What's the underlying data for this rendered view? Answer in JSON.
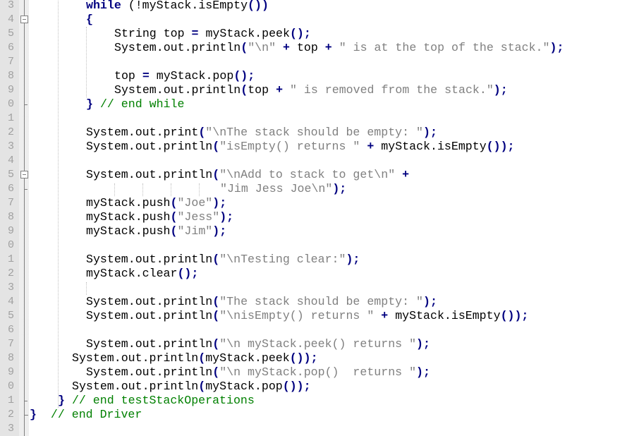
{
  "editor": {
    "lines": [
      {
        "number": "3",
        "indent": 8,
        "tokens": [
          {
            "t": "kw",
            "v": "while"
          },
          {
            "t": "tx",
            "v": " ("
          },
          {
            "t": "tx",
            "v": "!myStack.isEmpty"
          },
          {
            "t": "op",
            "v": "())"
          }
        ]
      },
      {
        "number": "4",
        "indent": 8,
        "tokens": [
          {
            "t": "op",
            "v": "{"
          }
        ]
      },
      {
        "number": "5",
        "indent": 12,
        "tokens": [
          {
            "t": "tx",
            "v": "String top "
          },
          {
            "t": "op",
            "v": "="
          },
          {
            "t": "tx",
            "v": " myStack.peek"
          },
          {
            "t": "op",
            "v": "();"
          }
        ]
      },
      {
        "number": "6",
        "indent": 12,
        "tokens": [
          {
            "t": "tx",
            "v": "System.out.println"
          },
          {
            "t": "op",
            "v": "("
          },
          {
            "t": "str",
            "v": "\"\\n\""
          },
          {
            "t": "tx",
            "v": " "
          },
          {
            "t": "op",
            "v": "+"
          },
          {
            "t": "tx",
            "v": " top "
          },
          {
            "t": "op",
            "v": "+"
          },
          {
            "t": "tx",
            "v": " "
          },
          {
            "t": "str",
            "v": "\" is at the top of the stack.\""
          },
          {
            "t": "op",
            "v": ");"
          }
        ]
      },
      {
        "number": "7",
        "indent": 0,
        "tokens": []
      },
      {
        "number": "8",
        "indent": 12,
        "tokens": [
          {
            "t": "tx",
            "v": "top "
          },
          {
            "t": "op",
            "v": "="
          },
          {
            "t": "tx",
            "v": " myStack.pop"
          },
          {
            "t": "op",
            "v": "();"
          }
        ]
      },
      {
        "number": "9",
        "indent": 12,
        "tokens": [
          {
            "t": "tx",
            "v": "System.out.println"
          },
          {
            "t": "op",
            "v": "("
          },
          {
            "t": "tx",
            "v": "top "
          },
          {
            "t": "op",
            "v": "+"
          },
          {
            "t": "tx",
            "v": " "
          },
          {
            "t": "str",
            "v": "\" is removed from the stack.\""
          },
          {
            "t": "op",
            "v": ");"
          }
        ]
      },
      {
        "number": "0",
        "indent": 8,
        "tokens": [
          {
            "t": "op",
            "v": "}"
          },
          {
            "t": "tx",
            "v": " "
          },
          {
            "t": "cm",
            "v": "// end while"
          }
        ]
      },
      {
        "number": "1",
        "indent": 0,
        "tokens": []
      },
      {
        "number": "2",
        "indent": 8,
        "tokens": [
          {
            "t": "tx",
            "v": "System.out.print"
          },
          {
            "t": "op",
            "v": "("
          },
          {
            "t": "str",
            "v": "\"\\nThe stack should be empty: \""
          },
          {
            "t": "op",
            "v": ");"
          }
        ]
      },
      {
        "number": "3",
        "indent": 8,
        "tokens": [
          {
            "t": "tx",
            "v": "System.out.println"
          },
          {
            "t": "op",
            "v": "("
          },
          {
            "t": "str",
            "v": "\"isEmpty() returns \""
          },
          {
            "t": "tx",
            "v": " "
          },
          {
            "t": "op",
            "v": "+"
          },
          {
            "t": "tx",
            "v": " myStack.isEmpty"
          },
          {
            "t": "op",
            "v": "());"
          }
        ]
      },
      {
        "number": "4",
        "indent": 0,
        "tokens": []
      },
      {
        "number": "5",
        "indent": 8,
        "tokens": [
          {
            "t": "tx",
            "v": "System.out.println"
          },
          {
            "t": "op",
            "v": "("
          },
          {
            "t": "str",
            "v": "\"\\nAdd to stack to get\\n\""
          },
          {
            "t": "tx",
            "v": " "
          },
          {
            "t": "op",
            "v": "+"
          }
        ]
      },
      {
        "number": "6",
        "indent": 27,
        "tokens": [
          {
            "t": "str",
            "v": "\"Jim Jess Joe\\n\""
          },
          {
            "t": "op",
            "v": ");"
          }
        ]
      },
      {
        "number": "7",
        "indent": 8,
        "tokens": [
          {
            "t": "tx",
            "v": "myStack.push"
          },
          {
            "t": "op",
            "v": "("
          },
          {
            "t": "str",
            "v": "\"Joe\""
          },
          {
            "t": "op",
            "v": ");"
          }
        ]
      },
      {
        "number": "8",
        "indent": 8,
        "tokens": [
          {
            "t": "tx",
            "v": "myStack.push"
          },
          {
            "t": "op",
            "v": "("
          },
          {
            "t": "str",
            "v": "\"Jess\""
          },
          {
            "t": "op",
            "v": ");"
          }
        ]
      },
      {
        "number": "9",
        "indent": 8,
        "tokens": [
          {
            "t": "tx",
            "v": "myStack.push"
          },
          {
            "t": "op",
            "v": "("
          },
          {
            "t": "str",
            "v": "\"Jim\""
          },
          {
            "t": "op",
            "v": ");"
          }
        ]
      },
      {
        "number": "0",
        "indent": 0,
        "tokens": []
      },
      {
        "number": "1",
        "indent": 8,
        "tokens": [
          {
            "t": "tx",
            "v": "System.out.println"
          },
          {
            "t": "op",
            "v": "("
          },
          {
            "t": "str",
            "v": "\"\\nTesting clear:\""
          },
          {
            "t": "op",
            "v": ");"
          }
        ]
      },
      {
        "number": "2",
        "indent": 8,
        "tokens": [
          {
            "t": "tx",
            "v": "myStack.clear"
          },
          {
            "t": "op",
            "v": "();"
          }
        ]
      },
      {
        "number": "3",
        "indent": 0,
        "tokens": []
      },
      {
        "number": "4",
        "indent": 8,
        "tokens": [
          {
            "t": "tx",
            "v": "System.out.println"
          },
          {
            "t": "op",
            "v": "("
          },
          {
            "t": "str",
            "v": "\"The stack should be empty: \""
          },
          {
            "t": "op",
            "v": ");"
          }
        ]
      },
      {
        "number": "5",
        "indent": 8,
        "tokens": [
          {
            "t": "tx",
            "v": "System.out.println"
          },
          {
            "t": "op",
            "v": "("
          },
          {
            "t": "str",
            "v": "\"\\nisEmpty() returns \""
          },
          {
            "t": "tx",
            "v": " "
          },
          {
            "t": "op",
            "v": "+"
          },
          {
            "t": "tx",
            "v": " myStack.isEmpty"
          },
          {
            "t": "op",
            "v": "());"
          }
        ]
      },
      {
        "number": "6",
        "indent": 0,
        "tokens": []
      },
      {
        "number": "7",
        "indent": 8,
        "tokens": [
          {
            "t": "tx",
            "v": "System.out.println"
          },
          {
            "t": "op",
            "v": "("
          },
          {
            "t": "str",
            "v": "\"\\n myStack.peek() returns \""
          },
          {
            "t": "op",
            "v": ");"
          }
        ]
      },
      {
        "number": "8",
        "indent": 6,
        "tokens": [
          {
            "t": "tx",
            "v": "System.out.println"
          },
          {
            "t": "op",
            "v": "("
          },
          {
            "t": "tx",
            "v": "myStack.peek"
          },
          {
            "t": "op",
            "v": "());"
          }
        ]
      },
      {
        "number": "9",
        "indent": 8,
        "tokens": [
          {
            "t": "tx",
            "v": "System.out.println"
          },
          {
            "t": "op",
            "v": "("
          },
          {
            "t": "str",
            "v": "\"\\n myStack.pop()  returns \""
          },
          {
            "t": "op",
            "v": ");"
          }
        ]
      },
      {
        "number": "0",
        "indent": 6,
        "tokens": [
          {
            "t": "tx",
            "v": "System.out.println"
          },
          {
            "t": "op",
            "v": "("
          },
          {
            "t": "tx",
            "v": "myStack.pop"
          },
          {
            "t": "op",
            "v": "());"
          }
        ]
      },
      {
        "number": "1",
        "indent": 4,
        "tokens": [
          {
            "t": "op",
            "v": "}"
          },
          {
            "t": "tx",
            "v": " "
          },
          {
            "t": "cm",
            "v": "// end testStackOperations"
          }
        ]
      },
      {
        "number": "2",
        "indent": 0,
        "tokens": [
          {
            "t": "op",
            "v": "}"
          },
          {
            "t": "tx",
            "v": "  "
          },
          {
            "t": "cm",
            "v": "// end Driver"
          }
        ]
      },
      {
        "number": "3",
        "indent": 0,
        "tokens": []
      }
    ],
    "colors": {
      "keyword": "#000080",
      "operator": "#000080",
      "string": "#808080",
      "comment": "#008000",
      "line_number": "#a0a0a0",
      "gutter": "#e4e4e4"
    }
  }
}
